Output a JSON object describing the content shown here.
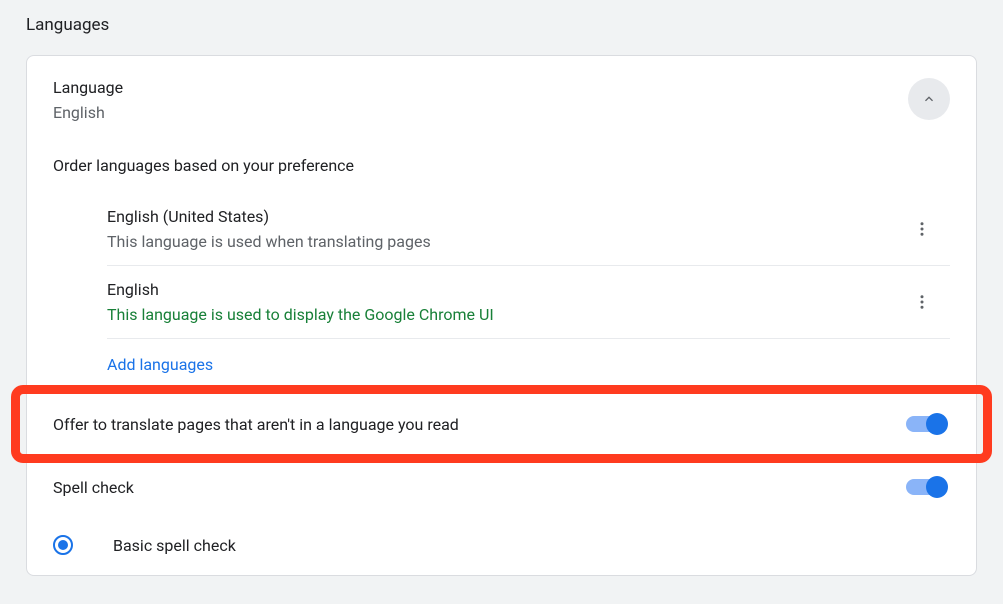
{
  "page": {
    "title": "Languages"
  },
  "language_section": {
    "header_title": "Language",
    "header_value": "English",
    "order_text": "Order languages based on your preference",
    "items": [
      {
        "name": "English (United States)",
        "desc": "This language is used when translating pages",
        "desc_class": ""
      },
      {
        "name": "English",
        "desc": "This language is used to display the Google Chrome UI",
        "desc_class": "green"
      }
    ],
    "add_languages_label": "Add languages"
  },
  "translate_toggle": {
    "label": "Offer to translate pages that aren't in a language you read",
    "state": "on"
  },
  "spellcheck_toggle": {
    "label": "Spell check",
    "state": "on"
  },
  "spellcheck_option": {
    "label": "Basic spell check",
    "selected": true
  }
}
